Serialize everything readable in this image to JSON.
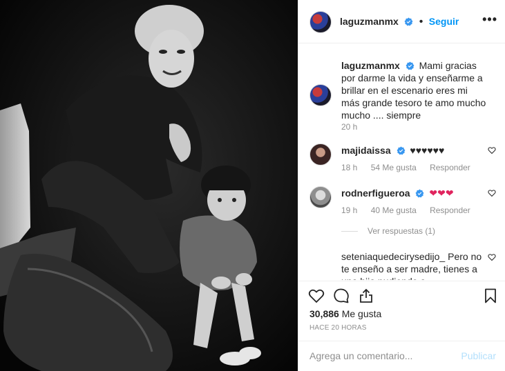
{
  "post": {
    "photo_alt": "black and white photo of a woman and a toddler"
  },
  "header": {
    "username": "laguzmanmx",
    "separator": "•",
    "follow_label": "Seguir",
    "more_icon": "more-dots-icon"
  },
  "caption": {
    "username": "laguzmanmx",
    "text": "Mami gracias por darme la vida y enseñarme a brillar en el escenario eres mi más grande tesoro te amo mucho mucho .... siempre",
    "time": "20 h"
  },
  "comments": [
    {
      "username": "majidaissa",
      "text": "♥♥♥♥♥♥",
      "time": "18 h",
      "likes": "54 Me gusta",
      "reply": "Responder"
    },
    {
      "username": "rodnerfigueroa",
      "text": "❤❤❤",
      "time": "19 h",
      "likes": "40 Me gusta",
      "reply": "Responder",
      "view_replies": "Ver respuestas (1)"
    },
    {
      "username": "seteniaquedecirysedijo_",
      "text": "Pero no te enseño a ser madre, tienes a una hija pudiendo a..."
    }
  ],
  "footer": {
    "likes_count": "30,886",
    "likes_label": "Me gusta",
    "timestamp": "HACE 20 HORAS",
    "comment_placeholder": "Agrega un comentario...",
    "publish_label": "Publicar"
  },
  "colors": {
    "accent": "#0095f6",
    "verified": "#3897f0",
    "muted": "#8e8e8e",
    "hearts": "#e0245e"
  }
}
